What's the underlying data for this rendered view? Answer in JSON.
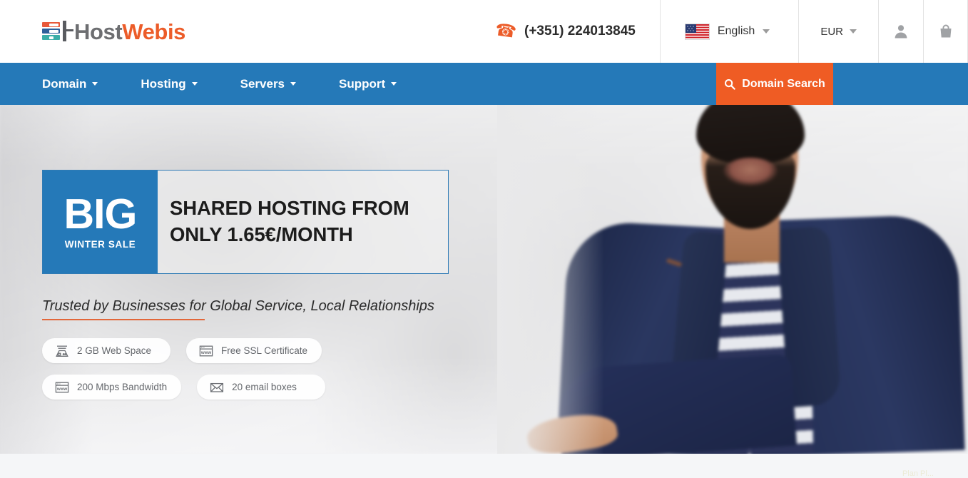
{
  "brand": {
    "name_part1": "Host",
    "name_part2": "Webis",
    "logo_icon": "server-stack-icon",
    "accent_orange": "#ec5c29",
    "accent_blue": "#2579b8",
    "gray": "#6d6e71"
  },
  "header": {
    "phone_icon": "phone-icon",
    "phone": "(+351) 224013845",
    "language": "English",
    "language_flag": "us-flag-icon",
    "currency": "EUR",
    "account_icon": "user-icon",
    "cart_icon": "shopping-bag-icon"
  },
  "nav": {
    "items": [
      {
        "label": "Domain"
      },
      {
        "label": "Hosting"
      },
      {
        "label": "Servers"
      },
      {
        "label": "Support"
      }
    ],
    "search_button": {
      "label": "Domain Search",
      "icon": "search-icon",
      "color": "#ef5c24"
    }
  },
  "hero": {
    "promo": {
      "big": "BIG",
      "sub": "WINTER SALE",
      "headline_line1": "SHARED HOSTING FROM",
      "headline_line2": "ONLY 1.65€/MONTH"
    },
    "tagline": "Trusted by Businesses for Global Service, Local Relationships",
    "badges": [
      {
        "icon": "server-disk-icon",
        "label": "2 GB Web Space"
      },
      {
        "icon": "browser-www-icon",
        "label": "Free SSL Certificate"
      },
      {
        "icon": "browser-www-icon",
        "label": "200 Mbps Bandwidth"
      },
      {
        "icon": "envelope-icon",
        "label": "20 email boxes"
      }
    ]
  },
  "footer": {
    "tiny_text": "Plan Pl..."
  }
}
